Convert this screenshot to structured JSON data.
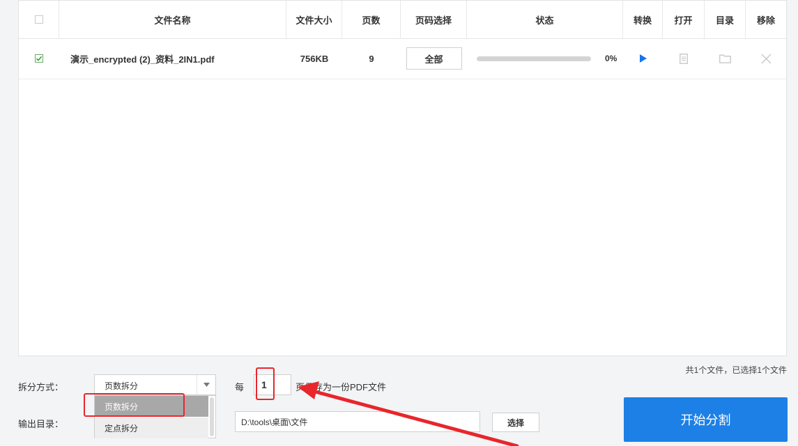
{
  "table": {
    "headers": {
      "name": "文件名称",
      "size": "文件大小",
      "pages": "页数",
      "page_select": "页码选择",
      "status": "状态",
      "convert": "转换",
      "open": "打开",
      "directory": "目录",
      "remove": "移除"
    },
    "rows": [
      {
        "checked": true,
        "name": "演示_encrypted (2)_资料_2IN1.pdf",
        "size": "756KB",
        "pages": "9",
        "page_select": "全部",
        "progress_percent": 0,
        "progress_label": "0%"
      }
    ]
  },
  "split": {
    "label": "拆分方式：",
    "selected": "页数拆分",
    "options": [
      "页数拆分",
      "定点拆分"
    ],
    "every_label": "每",
    "every_value": "1",
    "every_suffix": "页保存为一份PDF文件"
  },
  "output": {
    "label": "输出目录：",
    "path": "D:\\tools\\桌面\\文件",
    "choose_button": "选择"
  },
  "summary": "共1个文件，已选择1个文件",
  "start_button": "开始分割",
  "colors": {
    "accent": "#1d80e6",
    "annotation": "#e8262b",
    "play": "#1a73e8"
  },
  "icons": [
    "play-icon",
    "document-icon",
    "folder-icon",
    "close-icon",
    "check-icon",
    "chevron-down-icon"
  ]
}
